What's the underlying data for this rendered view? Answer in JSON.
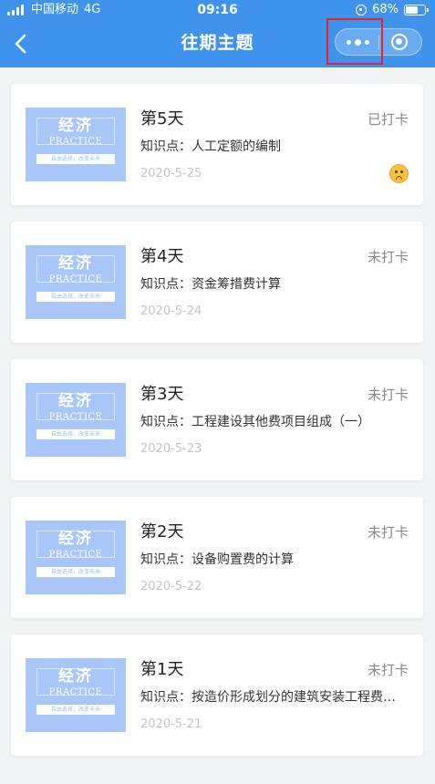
{
  "status_bar": {
    "carrier": "中国移动",
    "network": "4G",
    "time": "09:16",
    "battery_percent": "68%",
    "battery_level": 0.68,
    "icons": [
      "signal-icon",
      "orientation-lock-icon",
      "battery-icon"
    ]
  },
  "nav": {
    "back_icon": "chevron-left-icon",
    "title": "往期主题",
    "capsule_icons": [
      "more-icon",
      "close-icon"
    ]
  },
  "thumbnail": {
    "title": "经济",
    "subtitle": "PRACTICE",
    "slogan": "自由选择，改变未来"
  },
  "topic_prefix": "知识点：",
  "colors": {
    "header": "#3f93ec",
    "highlight": "#e8212a",
    "thumbnail": "#a8c6f8",
    "background": "#f3f4f6"
  },
  "items": [
    {
      "day": "第5天",
      "status": "已打卡",
      "topic": "人工定额的编制",
      "date": "2020-5-25",
      "mood_icon": "sad-face-icon"
    },
    {
      "day": "第4天",
      "status": "未打卡",
      "topic": "资金筹措费计算",
      "date": "2020-5-24"
    },
    {
      "day": "第3天",
      "status": "未打卡",
      "topic": "工程建设其他费项目组成（一）",
      "date": "2020-5-23"
    },
    {
      "day": "第2天",
      "status": "未打卡",
      "topic": "设备购置费的计算",
      "date": "2020-5-22"
    },
    {
      "day": "第1天",
      "status": "未打卡",
      "topic": "按造价形成划分的建筑安装工程费用项目组成",
      "date": "2020-5-21"
    }
  ]
}
